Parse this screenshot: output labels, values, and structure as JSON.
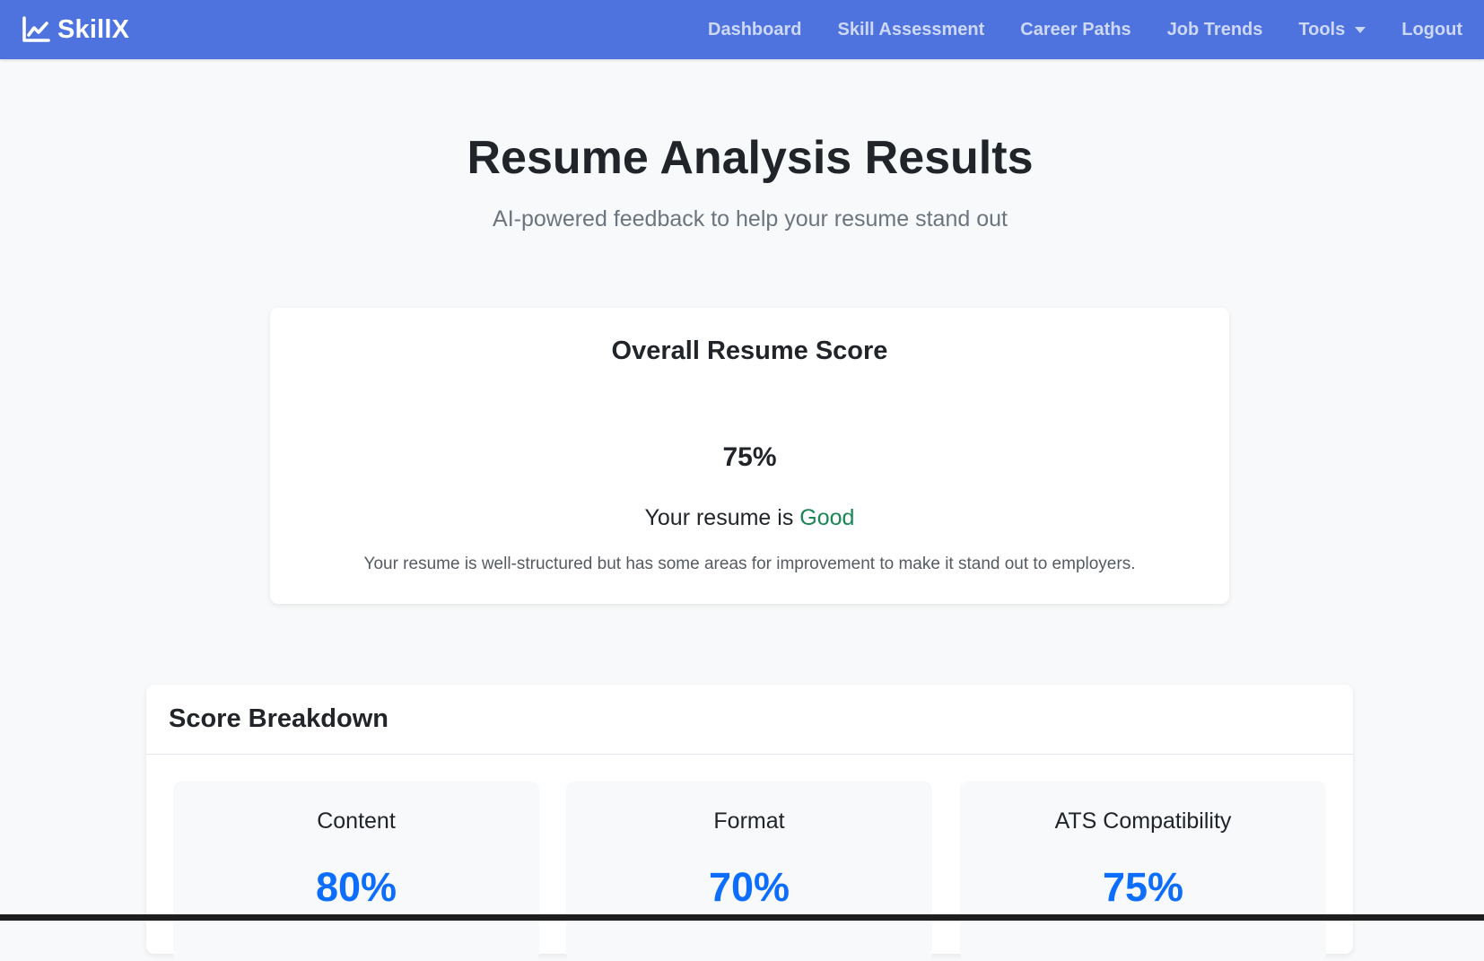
{
  "navbar": {
    "brand": "SkillX",
    "brand_icon": "line-chart-icon",
    "links": [
      {
        "label": "Dashboard"
      },
      {
        "label": "Skill Assessment"
      },
      {
        "label": "Career Paths"
      },
      {
        "label": "Job Trends"
      },
      {
        "label": "Tools",
        "dropdown": true
      },
      {
        "label": "Logout"
      }
    ],
    "color": "#4e73df"
  },
  "header": {
    "title": "Resume Analysis Results",
    "subtitle": "AI-powered feedback to help your resume stand out"
  },
  "overall_score": {
    "title": "Overall Resume Score",
    "value": "75%",
    "verdict_prefix": "Your resume is",
    "verdict": "Good",
    "verdict_color": "#198754",
    "description": "Your resume is well-structured but has some areas for improvement to make it stand out to employers."
  },
  "breakdown": {
    "title": "Score Breakdown",
    "metrics": [
      {
        "label": "Content",
        "value": "80%"
      },
      {
        "label": "Format",
        "value": "70%"
      },
      {
        "label": "ATS Compatibility",
        "value": "75%"
      }
    ],
    "value_color": "#0d6efd"
  }
}
